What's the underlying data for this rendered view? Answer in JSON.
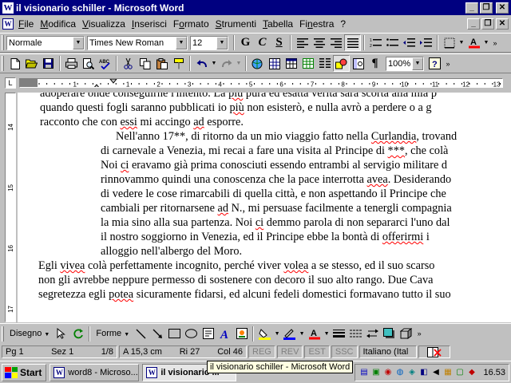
{
  "window": {
    "title": "il visionario schiller - Microsoft Word"
  },
  "menubar": {
    "items": [
      {
        "label": "File",
        "key": "F"
      },
      {
        "label": "Modifica",
        "key": "M"
      },
      {
        "label": "Visualizza",
        "key": "V"
      },
      {
        "label": "Inserisci",
        "key": "I"
      },
      {
        "label": "Formato",
        "key": "o"
      },
      {
        "label": "Strumenti",
        "key": "S"
      },
      {
        "label": "Tabella",
        "key": "T"
      },
      {
        "label": "Finestra",
        "key": "n"
      },
      {
        "label": "?",
        "key": ""
      }
    ]
  },
  "formatting": {
    "style": "Normale",
    "font": "Times New Roman",
    "size": "12",
    "bold": "G",
    "italic": "C",
    "underline": "S"
  },
  "standard": {
    "zoom": "100%"
  },
  "ruler": {
    "numbers": [
      "1",
      "1",
      "2",
      "3",
      "4",
      "5",
      "6",
      "7",
      "8",
      "9",
      "10",
      "11",
      "12",
      "13",
      "14",
      "15"
    ]
  },
  "vruler": {
    "numbers": [
      "14",
      "15",
      "16",
      "17"
    ]
  },
  "document": {
    "lines": [
      {
        "t": "adoperare onde conseguirne l'intento. La più pura ed esatta verità sarà scorta alla mia p",
        "cls": "cutop"
      },
      {
        "t": "quando questi fogli saranno pubblicati io più non esisterò, e nulla avrò a perdere o a g",
        "cls": ""
      },
      {
        "t": "racconto che con essi mi accingo ad esporre.",
        "cls": ""
      },
      {
        "t": "Nell'anno 17**, di ritorno da un mio viaggio fatto nella Curlandia, trovand",
        "cls": "ind1"
      },
      {
        "t": "di carnevale a Venezia, mi recai a fare una visita al Principe di ***, che colà",
        "cls": "ind2"
      },
      {
        "t": "Noi ci eravamo già prima conosciuti essendo entrambi al servigio militare d",
        "cls": "ind2"
      },
      {
        "t": "rinnovammo quindi una conoscenza che la pace interrotta avea. Desiderando",
        "cls": "ind2"
      },
      {
        "t": "di vedere le cose rimarcabili di quella città, e non aspettando il Principe che",
        "cls": "ind2"
      },
      {
        "t": "cambiali per ritornarsene ad N., mi persuase facilmente a tenergli compagnia",
        "cls": "ind2"
      },
      {
        "t": "la mia sino alla sua partenza. Noi ci demmo parola di non separarci l'uno dal",
        "cls": "ind2"
      },
      {
        "t": "il nostro soggiorno in Venezia, ed il Principe ebbe la bontà di offerirmi i",
        "cls": "ind2"
      },
      {
        "t": "alloggio nell'albergo del Moro.",
        "cls": "ind2"
      },
      {
        "t": "Egli vivea colà perfettamente incognito, perché viver volea a se stesso, ed il suo scarso",
        "cls": "outd"
      },
      {
        "t": "non gli avrebbe neppure permesso di sostenere con decoro il suo alto rango. Due Cava",
        "cls": "outd"
      },
      {
        "t": "segretezza egli potea sicuramente fidarsi, ed alcuni fedeli domestici formavano tutto il suo",
        "cls": "outd"
      }
    ]
  },
  "drawing": {
    "draw_label": "Disegno",
    "shapes_label": "Forme"
  },
  "status": {
    "page": "Pg 1",
    "section": "Sez 1",
    "pages": "1/8",
    "at": "A 15,3 cm",
    "line": "Ri 27",
    "col": "Col 46",
    "rec": "REG",
    "rev": "REV",
    "ext": "EST",
    "ovr": "SSC",
    "language": "Italiano (Ital"
  },
  "taskbar": {
    "start": "Start",
    "tasks": [
      {
        "label": "word8 - Microso...",
        "active": false
      },
      {
        "label": "il visionario ...",
        "active": true
      }
    ],
    "clock": "16.53"
  },
  "tooltip": "il visionario schiller - Microsoft Word",
  "colors": {
    "titlebar": "#000080",
    "face": "#c0c0c0",
    "tooltip": "#ffffe1",
    "squiggle": "#ff0000"
  }
}
